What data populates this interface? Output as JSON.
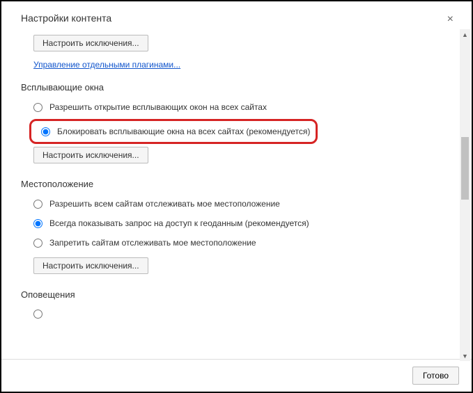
{
  "title": "Настройки контента",
  "close": "×",
  "btn_exceptions": "Настроить исключения...",
  "link_plugins": "Управление отдельными плагинами...",
  "popups": {
    "title": "Всплывающие окна",
    "allow": "Разрешить открытие всплывающих окон на всех сайтах",
    "block": "Блокировать всплывающие окна на всех сайтах (рекомендуется)"
  },
  "location": {
    "title": "Местоположение",
    "allow": "Разрешить всем сайтам отслеживать мое местоположение",
    "ask": "Всегда показывать запрос на доступ к геоданным (рекомендуется)",
    "deny": "Запретить сайтам отслеживать мое местоположение"
  },
  "notifications": {
    "title": "Оповещения"
  },
  "done": "Готово"
}
